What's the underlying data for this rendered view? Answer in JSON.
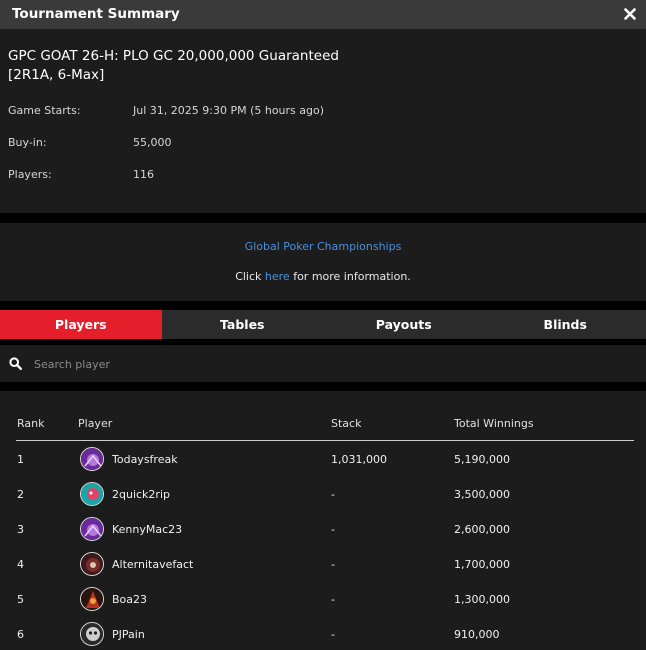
{
  "header": {
    "title": "Tournament Summary",
    "close_icon": "close-x-icon"
  },
  "tournament": {
    "name_line1": "GPC GOAT 26-H: PLO GC 20,000,000 Guaranteed",
    "name_line2": "[2R1A, 6-Max]",
    "details": [
      {
        "label": "Game Starts:",
        "value": "Jul 31, 2025 9:30 PM (5 hours ago)"
      },
      {
        "label": "Buy-in:",
        "value": "55,000"
      },
      {
        "label": "Players:",
        "value": "116"
      }
    ]
  },
  "info": {
    "site_name": "Global Poker Championships",
    "more_prefix": "Click ",
    "more_link": "here",
    "more_suffix": " for more information."
  },
  "tabs": [
    {
      "label": "Players",
      "active": true
    },
    {
      "label": "Tables",
      "active": false
    },
    {
      "label": "Payouts",
      "active": false
    },
    {
      "label": "Blinds",
      "active": false
    }
  ],
  "search": {
    "placeholder": "Search player",
    "icon": "search-icon"
  },
  "table": {
    "headers": {
      "rank": "Rank",
      "player": "Player",
      "stack": "Stack",
      "winnings": "Total Winnings"
    },
    "rows": [
      {
        "rank": "1",
        "player": "Todaysfreak",
        "stack": "1,031,000",
        "winnings": "5,190,000",
        "avatar_color": "#6a2a9a"
      },
      {
        "rank": "2",
        "player": "2quick2rip",
        "stack": "-",
        "winnings": "3,500,000",
        "avatar_color": "#1aa6a6"
      },
      {
        "rank": "3",
        "player": "KennyMac23",
        "stack": "-",
        "winnings": "2,600,000",
        "avatar_color": "#6a2a9a"
      },
      {
        "rank": "4",
        "player": "Alternitavefact",
        "stack": "-",
        "winnings": "1,700,000",
        "avatar_color": "#7a2a2a"
      },
      {
        "rank": "5",
        "player": "Boa23",
        "stack": "-",
        "winnings": "1,300,000",
        "avatar_color": "#b8321e"
      },
      {
        "rank": "6",
        "player": "PJPain",
        "stack": "-",
        "winnings": "910,000",
        "avatar_color": "#5a5a5a"
      }
    ]
  },
  "colors": {
    "accent": "#e41e2b",
    "link": "#4a8fdc",
    "panel": "#1c1c1c",
    "titlebar": "#3a3a3a"
  }
}
